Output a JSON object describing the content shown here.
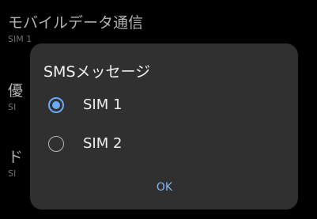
{
  "background": {
    "settings": [
      {
        "title": "モバイルデータ通信",
        "subtitle": "SIM 1"
      },
      {
        "title": "優",
        "subtitle": "SI"
      },
      {
        "title": "ド",
        "subtitle": "SI"
      }
    ]
  },
  "dialog": {
    "title": "SMSメッセージ",
    "options": [
      {
        "label": "SIM 1",
        "selected": true
      },
      {
        "label": "SIM 2",
        "selected": false
      }
    ],
    "ok_label": "OK"
  },
  "colors": {
    "accent": "#6aa9f5",
    "dialog_background": "#303030",
    "page_background": "#000000"
  }
}
